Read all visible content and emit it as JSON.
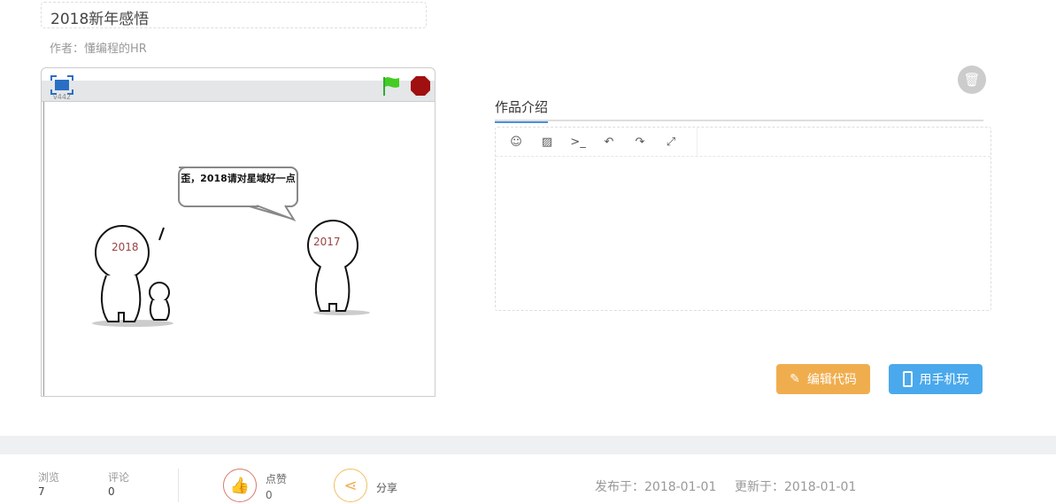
{
  "title": "2018新年感悟",
  "author": "作者：懂编程的HR",
  "player": {
    "version": "v442",
    "speech": "歪，2018请对星域好一点",
    "char_left": "2018",
    "char_right": "2017"
  },
  "tab": "作品介绍",
  "editor_tools": [
    "emoji-icon",
    "image-icon",
    "code-icon",
    "undo-icon",
    "redo-icon",
    "fullscreen-icon"
  ],
  "buttons": {
    "edit": "编辑代码",
    "mobile": "用手机玩"
  },
  "stats": {
    "views_label": "浏览",
    "views": "7",
    "comments_label": "评论",
    "comments": "0",
    "like_label": "点赞",
    "likes": "0",
    "share_label": "分享"
  },
  "dates": {
    "published": "发布于：2018-01-01",
    "updated": "更新于：2018-01-01"
  },
  "colors": {
    "accent": "#4a90d9",
    "edit": "#f0ad4e",
    "mobile": "#4aa9ec"
  }
}
